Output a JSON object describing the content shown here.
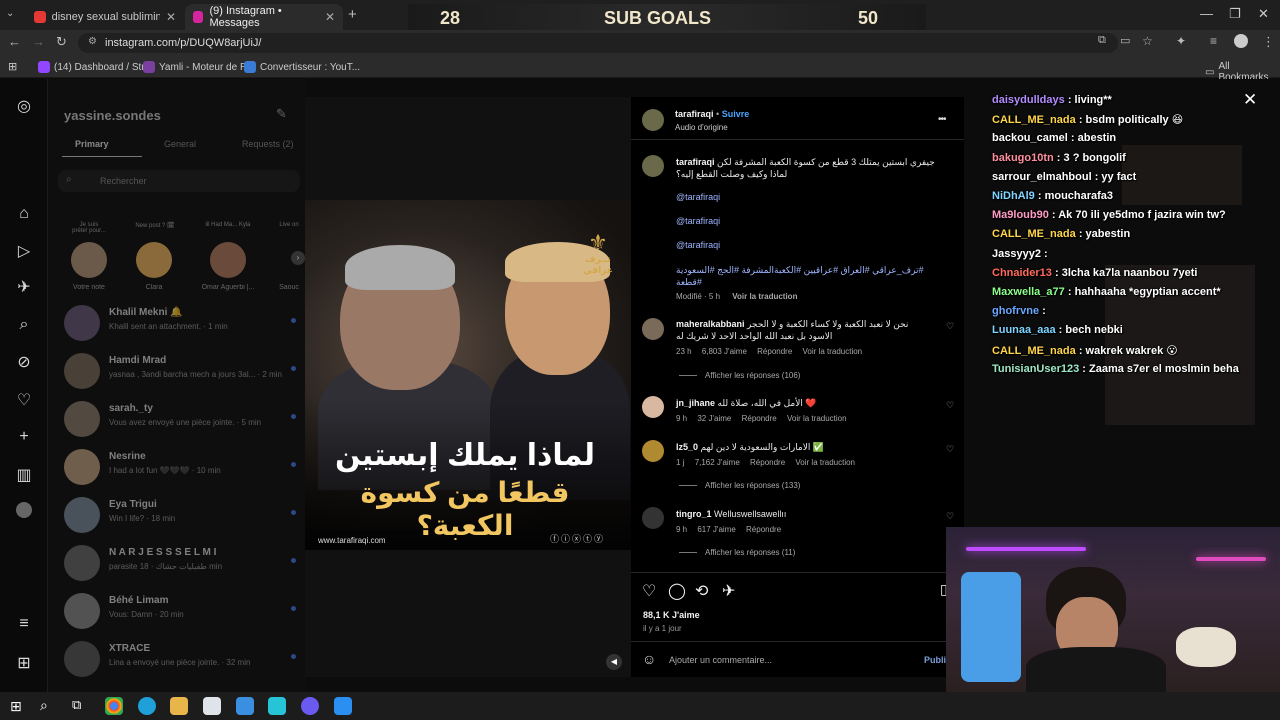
{
  "browser": {
    "tabs": [
      {
        "title": "disney sexual subliminal messa",
        "color": "#e53935"
      },
      {
        "title": "(9) Instagram • Messages",
        "color": "#d6249f"
      }
    ],
    "new_tab": "+",
    "url": "instagram.com/p/DUQW8arjUiJ/",
    "bookmarks": [
      {
        "label": "(14) Dashboard / Str..."
      },
      {
        "label": "Yamli - Moteur de R..."
      },
      {
        "label": "Convertisseur : YouT..."
      }
    ],
    "all_bookmarks": "All Bookmarks"
  },
  "sub_goals": {
    "left": "28",
    "title": "SUB GOALS",
    "right": "50"
  },
  "dm": {
    "username": "yassine.sondes",
    "tabs": [
      "Primary",
      "General",
      "Requests (2)"
    ],
    "search_placeholder": "Rechercher",
    "notes": [
      {
        "note": "Je suis préte! pour...",
        "name": "Votre note"
      },
      {
        "note": "New post ? 🗓",
        "name": "Clara"
      },
      {
        "note": "lil Had Ma... Kyla",
        "name": "Omar Aguerbi |..."
      },
      {
        "note": "Live on",
        "name": "Saouc"
      }
    ],
    "threads": [
      {
        "name": "Khalil Mekni 🔔",
        "preview": "Khalil sent an attachment. · 1 min"
      },
      {
        "name": "Hamdi Mrad",
        "preview": "yasnaa , 3andi barcha mech a jours 3al... · 2 min"
      },
      {
        "name": "sarah._ty",
        "preview": "Vous avez envoyé une pièce jointe. · 5 min"
      },
      {
        "name": "Nesrine",
        "preview": "I had a lot fun 🖤🖤🖤 · 10 min"
      },
      {
        "name": "Eya Trigui",
        "preview": "Win I life? · 18 min"
      },
      {
        "name": "N A R J E S S S E L M I",
        "preview": "parasite طفيليات حشاك · 18 min"
      },
      {
        "name": "Béhé Limam",
        "preview": "Vous: Damn · 20 min"
      },
      {
        "name": "XTRACE",
        "preview": "Lina a envoyé une pièce jointe. · 32 min"
      }
    ]
  },
  "post": {
    "title_line1": "لماذا يملك إبستين",
    "title_line2": "قطعًا من كسوة الكعبة؟",
    "logo_text": "تــرف عراقي",
    "website": "www.tarafiraqi.com",
    "mute_icon": "speaker-icon"
  },
  "comments_panel": {
    "author": "tarafiraqi",
    "follow": "Suivre",
    "audio": "Audio d'origine",
    "more": "•••",
    "caption": {
      "user": "tarafiraqi",
      "text": "جيفري ابستين يمتلك 3 قطع من كسوة الكعبة المشرفة لكن لماذا وكيف وصلت القطع إليه؟",
      "mentions": [
        "@tarafiraqi",
        "@tarafiraqi",
        "@tarafiraqi"
      ],
      "hashtags": "#ترف_عراقي #العراق #عراقيين #الكعبةالمشرفة #الحج #السعودية #قطعة",
      "meta": "Modifié · 5 h",
      "translate": "Voir la traduction"
    },
    "comments": [
      {
        "user": "maheralkabbani",
        "text": "نحن لا نعبد الكعبة ولا كساء الكعبة و لا الحجر الاسود بل نعبد الله الواحد الاحد لا شريك له",
        "time": "23 h",
        "likes": "6,803 J'aime",
        "reply": "Répondre",
        "translate": "Voir la traduction",
        "view_replies": "Afficher les réponses (106)"
      },
      {
        "user": "jn_jihane",
        "text": "الأمل في الله، صلاة لله ❤️",
        "time": "9 h",
        "likes": "32 J'aime",
        "reply": "Répondre",
        "translate": "Voir la traduction",
        "view_replies": ""
      },
      {
        "user": "lz5_0",
        "text": "الامارات والسعودية لا دين لهم ✅",
        "time": "1 j",
        "likes": "7,162 J'aime",
        "reply": "Répondre",
        "translate": "Voir la traduction",
        "view_replies": "Afficher les réponses (133)"
      },
      {
        "user": "tingro_1",
        "text": "Welluswellsawellıı",
        "time": "9 h",
        "likes": "617 J'aime",
        "reply": "Répondre",
        "translate": "",
        "view_replies": "Afficher les réponses (11)"
      }
    ],
    "likes_total": "88,1 K J'aime",
    "posted": "il y a 1 jour",
    "add_comment_placeholder": "Ajouter un commentaire...",
    "publish": "Publi"
  },
  "chat": [
    {
      "user": "daisydulldays",
      "msg": ": living**",
      "color": "#b48cff"
    },
    {
      "user": "CALL_ME_nada",
      "msg": ": bsdm politically 😆",
      "color": "#ffd54a"
    },
    {
      "user": "backou_camel",
      "msg": ": abestin",
      "color": "#ffffff"
    },
    {
      "user": "bakugo10tn",
      "msg": ": 3 ? bongolif",
      "color": "#ff8fa0"
    },
    {
      "user": "sarrour_elmahboul",
      "msg": ": yy fact",
      "color": "#ffffff"
    },
    {
      "user": "NiDhAl9",
      "msg": ": moucharafa3",
      "color": "#7fd4ff"
    },
    {
      "user": "Ma9loub90",
      "msg": ": Ak 70 ili ye5dmo f jazira win tw?",
      "color": "#ff9cc4"
    },
    {
      "user": "CALL_ME_nada",
      "msg": ": yabestin",
      "color": "#ffd54a"
    },
    {
      "user": "Jassyyy2",
      "msg": ":",
      "color": "#ffffff"
    },
    {
      "user": "Chnaider13",
      "msg": ": 3lcha ka7la naanbou 7yeti",
      "color": "#ff6a5a"
    },
    {
      "user": "Maxwella_a77",
      "msg": ": hahhaaha *egyptian accent*",
      "color": "#8dff8d"
    },
    {
      "user": "ghofrvne",
      "msg": ":",
      "color": "#6aa8ff"
    },
    {
      "user": "Luunaa_aaa",
      "msg": ": bech nebki",
      "color": "#7fd4ff"
    },
    {
      "user": "CALL_ME_nada",
      "msg": ": wakrek wakrek 😮",
      "color": "#ffd54a"
    },
    {
      "user": "TunisianUser123",
      "msg": ": Zaama s7er el moslmin beha",
      "color": "#9fe8c8"
    }
  ]
}
